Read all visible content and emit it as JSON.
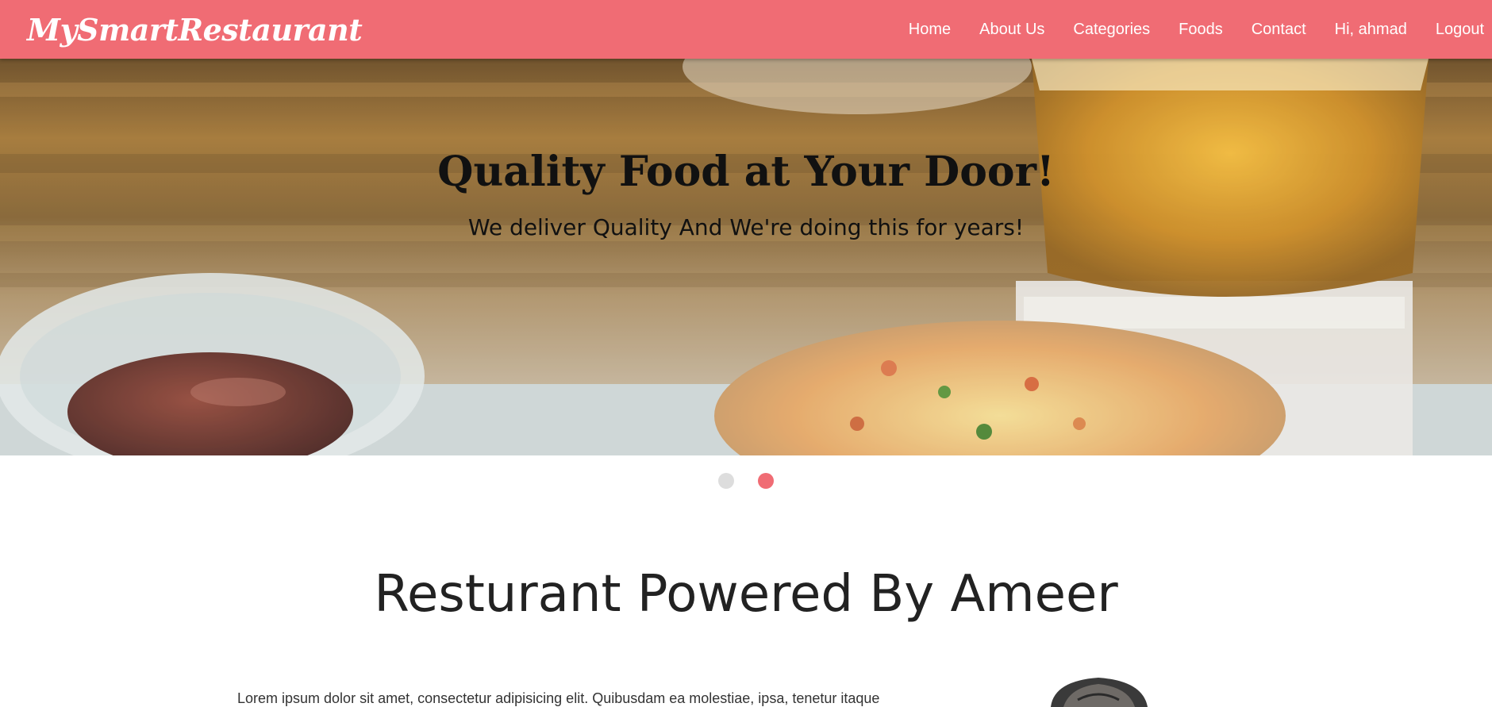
{
  "brand": {
    "name": "MySmartRestaurant"
  },
  "nav": {
    "items": [
      {
        "label": "Home"
      },
      {
        "label": "About Us"
      },
      {
        "label": "Categories"
      },
      {
        "label": "Foods"
      },
      {
        "label": "Contact"
      },
      {
        "label": "Hi, ahmad"
      },
      {
        "label": "Logout"
      }
    ]
  },
  "hero": {
    "title": "Quality Food at Your Door!",
    "subtitle": "We deliver Quality And We're doing this for years!"
  },
  "carousel": {
    "slides": 2,
    "active_index": 1
  },
  "about": {
    "title": "Resturant Powered By Ameer",
    "text": "Lorem ipsum dolor sit amet, consectetur adipisicing elit. Quibusdam ea molestiae, ipsa, tenetur itaque"
  },
  "colors": {
    "accent": "#f06c74",
    "dot_inactive": "#dddddd"
  }
}
